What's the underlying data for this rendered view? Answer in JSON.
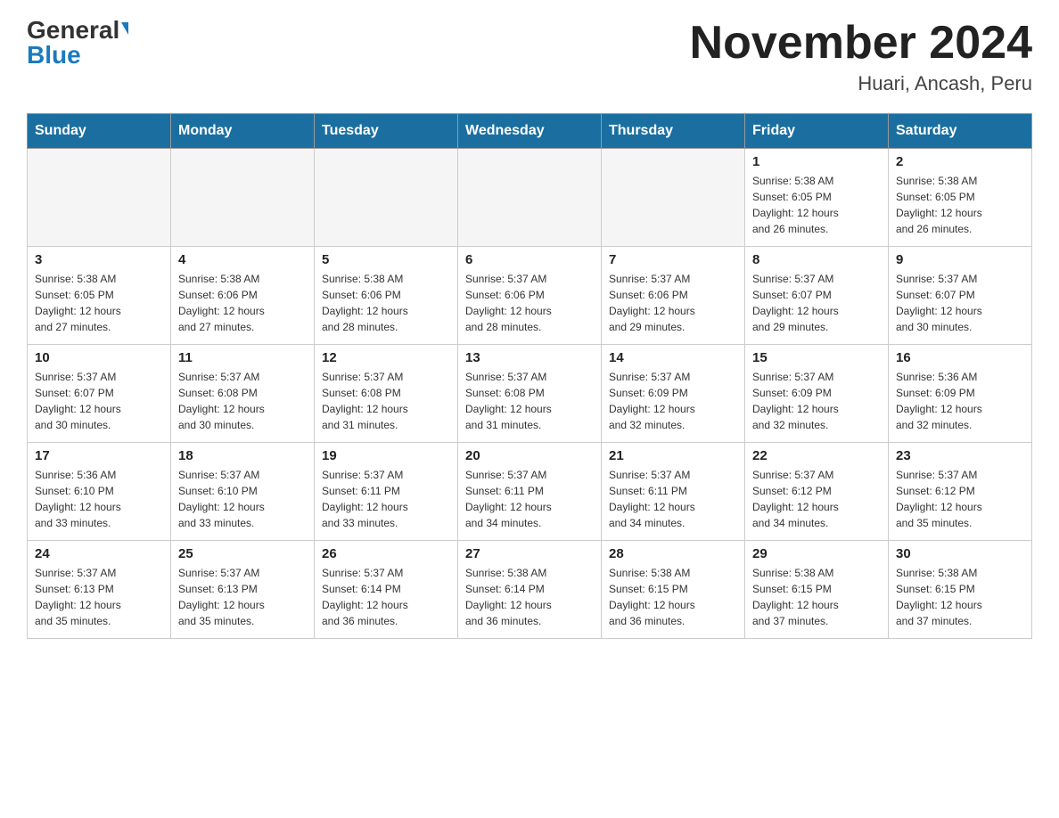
{
  "logo": {
    "general": "General",
    "blue": "Blue"
  },
  "title": {
    "month_year": "November 2024",
    "location": "Huari, Ancash, Peru"
  },
  "days_of_week": [
    "Sunday",
    "Monday",
    "Tuesday",
    "Wednesday",
    "Thursday",
    "Friday",
    "Saturday"
  ],
  "weeks": [
    [
      {
        "day": "",
        "info": ""
      },
      {
        "day": "",
        "info": ""
      },
      {
        "day": "",
        "info": ""
      },
      {
        "day": "",
        "info": ""
      },
      {
        "day": "",
        "info": ""
      },
      {
        "day": "1",
        "info": "Sunrise: 5:38 AM\nSunset: 6:05 PM\nDaylight: 12 hours\nand 26 minutes."
      },
      {
        "day": "2",
        "info": "Sunrise: 5:38 AM\nSunset: 6:05 PM\nDaylight: 12 hours\nand 26 minutes."
      }
    ],
    [
      {
        "day": "3",
        "info": "Sunrise: 5:38 AM\nSunset: 6:05 PM\nDaylight: 12 hours\nand 27 minutes."
      },
      {
        "day": "4",
        "info": "Sunrise: 5:38 AM\nSunset: 6:06 PM\nDaylight: 12 hours\nand 27 minutes."
      },
      {
        "day": "5",
        "info": "Sunrise: 5:38 AM\nSunset: 6:06 PM\nDaylight: 12 hours\nand 28 minutes."
      },
      {
        "day": "6",
        "info": "Sunrise: 5:37 AM\nSunset: 6:06 PM\nDaylight: 12 hours\nand 28 minutes."
      },
      {
        "day": "7",
        "info": "Sunrise: 5:37 AM\nSunset: 6:06 PM\nDaylight: 12 hours\nand 29 minutes."
      },
      {
        "day": "8",
        "info": "Sunrise: 5:37 AM\nSunset: 6:07 PM\nDaylight: 12 hours\nand 29 minutes."
      },
      {
        "day": "9",
        "info": "Sunrise: 5:37 AM\nSunset: 6:07 PM\nDaylight: 12 hours\nand 30 minutes."
      }
    ],
    [
      {
        "day": "10",
        "info": "Sunrise: 5:37 AM\nSunset: 6:07 PM\nDaylight: 12 hours\nand 30 minutes."
      },
      {
        "day": "11",
        "info": "Sunrise: 5:37 AM\nSunset: 6:08 PM\nDaylight: 12 hours\nand 30 minutes."
      },
      {
        "day": "12",
        "info": "Sunrise: 5:37 AM\nSunset: 6:08 PM\nDaylight: 12 hours\nand 31 minutes."
      },
      {
        "day": "13",
        "info": "Sunrise: 5:37 AM\nSunset: 6:08 PM\nDaylight: 12 hours\nand 31 minutes."
      },
      {
        "day": "14",
        "info": "Sunrise: 5:37 AM\nSunset: 6:09 PM\nDaylight: 12 hours\nand 32 minutes."
      },
      {
        "day": "15",
        "info": "Sunrise: 5:37 AM\nSunset: 6:09 PM\nDaylight: 12 hours\nand 32 minutes."
      },
      {
        "day": "16",
        "info": "Sunrise: 5:36 AM\nSunset: 6:09 PM\nDaylight: 12 hours\nand 32 minutes."
      }
    ],
    [
      {
        "day": "17",
        "info": "Sunrise: 5:36 AM\nSunset: 6:10 PM\nDaylight: 12 hours\nand 33 minutes."
      },
      {
        "day": "18",
        "info": "Sunrise: 5:37 AM\nSunset: 6:10 PM\nDaylight: 12 hours\nand 33 minutes."
      },
      {
        "day": "19",
        "info": "Sunrise: 5:37 AM\nSunset: 6:11 PM\nDaylight: 12 hours\nand 33 minutes."
      },
      {
        "day": "20",
        "info": "Sunrise: 5:37 AM\nSunset: 6:11 PM\nDaylight: 12 hours\nand 34 minutes."
      },
      {
        "day": "21",
        "info": "Sunrise: 5:37 AM\nSunset: 6:11 PM\nDaylight: 12 hours\nand 34 minutes."
      },
      {
        "day": "22",
        "info": "Sunrise: 5:37 AM\nSunset: 6:12 PM\nDaylight: 12 hours\nand 34 minutes."
      },
      {
        "day": "23",
        "info": "Sunrise: 5:37 AM\nSunset: 6:12 PM\nDaylight: 12 hours\nand 35 minutes."
      }
    ],
    [
      {
        "day": "24",
        "info": "Sunrise: 5:37 AM\nSunset: 6:13 PM\nDaylight: 12 hours\nand 35 minutes."
      },
      {
        "day": "25",
        "info": "Sunrise: 5:37 AM\nSunset: 6:13 PM\nDaylight: 12 hours\nand 35 minutes."
      },
      {
        "day": "26",
        "info": "Sunrise: 5:37 AM\nSunset: 6:14 PM\nDaylight: 12 hours\nand 36 minutes."
      },
      {
        "day": "27",
        "info": "Sunrise: 5:38 AM\nSunset: 6:14 PM\nDaylight: 12 hours\nand 36 minutes."
      },
      {
        "day": "28",
        "info": "Sunrise: 5:38 AM\nSunset: 6:15 PM\nDaylight: 12 hours\nand 36 minutes."
      },
      {
        "day": "29",
        "info": "Sunrise: 5:38 AM\nSunset: 6:15 PM\nDaylight: 12 hours\nand 37 minutes."
      },
      {
        "day": "30",
        "info": "Sunrise: 5:38 AM\nSunset: 6:15 PM\nDaylight: 12 hours\nand 37 minutes."
      }
    ]
  ]
}
